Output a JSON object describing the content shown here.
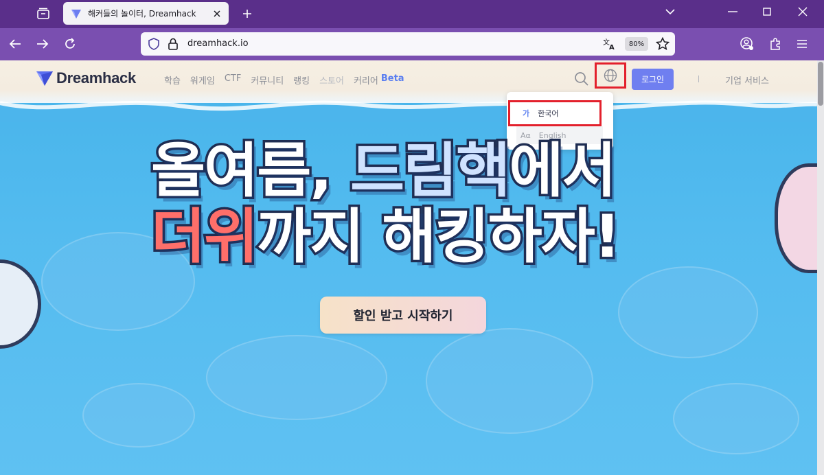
{
  "browser": {
    "tab": {
      "title": "해커들의 놀이터, Dreamhack"
    },
    "url": "dreamhack.io",
    "zoom": "80%"
  },
  "site": {
    "logo_text": "Dreamhack",
    "menu": [
      "학습",
      "워게임",
      "CTF",
      "커뮤니티",
      "랭킹",
      "스토어",
      "커리어"
    ],
    "beta": "Beta",
    "login": "로그인",
    "corporate": "기업 서비스"
  },
  "language_menu": {
    "items": [
      {
        "glyph": "가",
        "label": "한국어"
      },
      {
        "glyph": "Aα",
        "label": "English"
      }
    ]
  },
  "hero": {
    "line1_a": "올여름, ",
    "line1_b": "드림핵",
    "line1_c": "에서",
    "line2_a": "더위",
    "line2_b": "까지 해킹하자!",
    "cta": "할인 받고 시작하기"
  },
  "colors": {
    "tabbar": "#5a2f8a",
    "navbar": "#7a4fb0",
    "accent": "#6f7ff0",
    "highlight": "#e3202c"
  }
}
